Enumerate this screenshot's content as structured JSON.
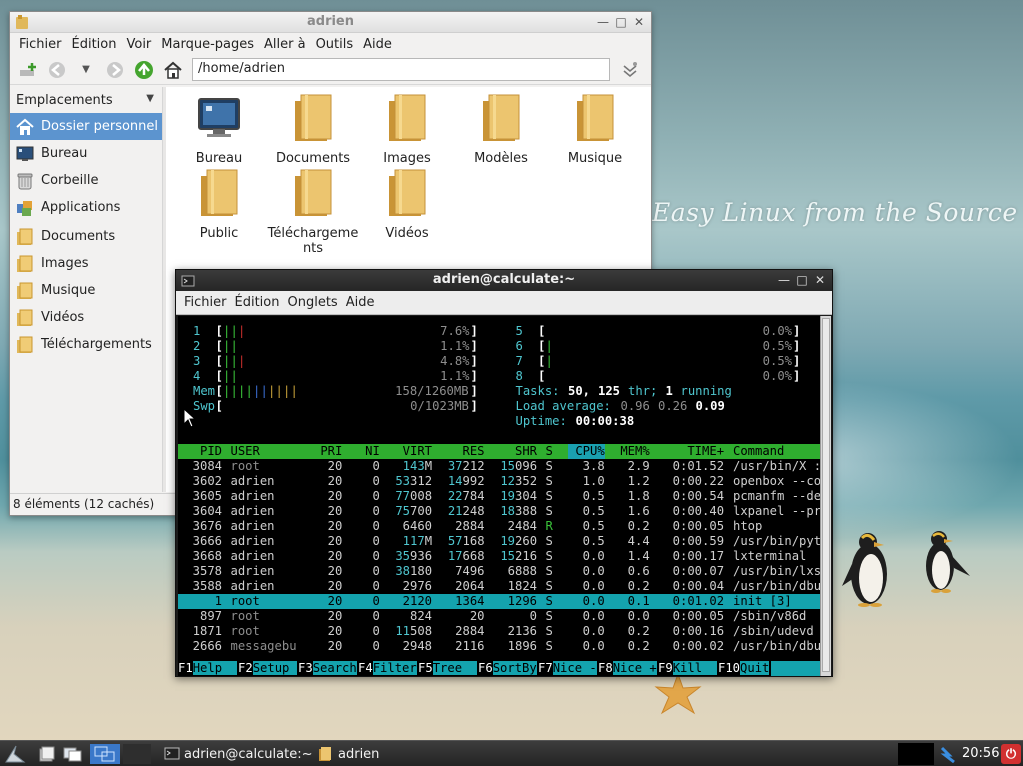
{
  "desktop": {
    "slogan": "Easy Linux from the Source"
  },
  "file_manager": {
    "title": "adrien",
    "menu": [
      "Fichier",
      "Édition",
      "Voir",
      "Marque-pages",
      "Aller à",
      "Outils",
      "Aide"
    ],
    "path": "/home/adrien",
    "sidebar_header": "Emplacements",
    "places": [
      {
        "label": "Dossier personnel",
        "icon": "home-icon",
        "active": true
      },
      {
        "label": "Bureau",
        "icon": "desktop-icon"
      },
      {
        "label": "Corbeille",
        "icon": "trash-icon"
      },
      {
        "label": "Applications",
        "icon": "applications-icon"
      }
    ],
    "bookmarks": [
      {
        "label": "Documents",
        "icon": "folder-icon"
      },
      {
        "label": "Images",
        "icon": "folder-icon"
      },
      {
        "label": "Musique",
        "icon": "folder-icon"
      },
      {
        "label": "Vidéos",
        "icon": "folder-icon"
      },
      {
        "label": "Téléchargements",
        "icon": "folder-icon"
      }
    ],
    "items": [
      {
        "label": "Bureau",
        "icon": "desktop-icon"
      },
      {
        "label": "Documents",
        "icon": "folder-icon"
      },
      {
        "label": "Images",
        "icon": "folder-icon"
      },
      {
        "label": "Modèles",
        "icon": "folder-icon"
      },
      {
        "label": "Musique",
        "icon": "folder-icon"
      },
      {
        "label": "Public",
        "icon": "folder-icon"
      },
      {
        "label": "Télécharge­ments",
        "line1": "Téléchargeme",
        "line2": "nts",
        "icon": "folder-icon"
      },
      {
        "label": "Vidéos",
        "icon": "folder-icon"
      }
    ],
    "status": "8 éléments (12 cachés)"
  },
  "terminal": {
    "title": "adrien@calculate:~",
    "menu": [
      "Fichier",
      "Édition",
      "Onglets",
      "Aide"
    ],
    "htop": {
      "cpus": [
        {
          "id": "1",
          "bar": "|||",
          "pct": "7.6%"
        },
        {
          "id": "2",
          "bar": "||",
          "pct": "1.1%"
        },
        {
          "id": "3",
          "bar": "|||",
          "pct": "4.8%"
        },
        {
          "id": "4",
          "bar": "||",
          "pct": "1.1%"
        },
        {
          "id": "5",
          "bar": "",
          "pct": "0.0%"
        },
        {
          "id": "6",
          "bar": "|",
          "pct": "0.5%"
        },
        {
          "id": "7",
          "bar": "|",
          "pct": "0.5%"
        },
        {
          "id": "8",
          "bar": "",
          "pct": "0.0%"
        }
      ],
      "mem_label": "Mem",
      "mem_value": "158/1260MB",
      "swp_label": "Swp",
      "swp_value": "0/1023MB",
      "tasks_label": "Tasks:",
      "tasks_count": "50",
      "threads": "125",
      "thr_label": "thr;",
      "running": "1",
      "running_label": "running",
      "load_label": "Load average:",
      "load1": "0.96",
      "load5": "0.26",
      "load15": "0.09",
      "uptime_label": "Uptime:",
      "uptime": "00:00:38",
      "columns": [
        "PID",
        "USER",
        "PRI",
        "NI",
        "VIRT",
        "RES",
        "SHR",
        "S",
        "CPU%",
        "MEM%",
        "TIME+",
        "Command"
      ],
      "processes": [
        {
          "pid": "3084",
          "user": "root",
          "pri": "20",
          "ni": "0",
          "virt": "143M",
          "res": "37212",
          "shr": "15096",
          "s": "S",
          "cpu": "3.8",
          "mem": "2.9",
          "time": "0:01.52",
          "cmd": "/usr/bin/X :0 -se"
        },
        {
          "pid": "3602",
          "user": "adrien",
          "pri": "20",
          "ni": "0",
          "virt": "53312",
          "res": "14992",
          "shr": "12352",
          "s": "S",
          "cpu": "1.0",
          "mem": "1.2",
          "time": "0:00.22",
          "cmd": "openbox --config-"
        },
        {
          "pid": "3605",
          "user": "adrien",
          "pri": "20",
          "ni": "0",
          "virt": "77008",
          "res": "22784",
          "shr": "19304",
          "s": "S",
          "cpu": "0.5",
          "mem": "1.8",
          "time": "0:00.54",
          "cmd": "pcmanfm --desktop"
        },
        {
          "pid": "3604",
          "user": "adrien",
          "pri": "20",
          "ni": "0",
          "virt": "75700",
          "res": "21248",
          "shr": "18388",
          "s": "S",
          "cpu": "0.5",
          "mem": "1.6",
          "time": "0:00.40",
          "cmd": "lxpanel --profile"
        },
        {
          "pid": "3676",
          "user": "adrien",
          "pri": "20",
          "ni": "0",
          "virt": "6460",
          "res": "2884",
          "shr": "2484",
          "s": "R",
          "cpu": "0.5",
          "mem": "0.2",
          "time": "0:00.05",
          "cmd": "htop"
        },
        {
          "pid": "3666",
          "user": "adrien",
          "pri": "20",
          "ni": "0",
          "virt": "117M",
          "res": "57168",
          "shr": "19260",
          "s": "S",
          "cpu": "0.5",
          "mem": "4.4",
          "time": "0:00.59",
          "cmd": "/usr/bin/python2."
        },
        {
          "pid": "3668",
          "user": "adrien",
          "pri": "20",
          "ni": "0",
          "virt": "35936",
          "res": "17668",
          "shr": "15216",
          "s": "S",
          "cpu": "0.0",
          "mem": "1.4",
          "time": "0:00.17",
          "cmd": "lxterminal"
        },
        {
          "pid": "3578",
          "user": "adrien",
          "pri": "20",
          "ni": "0",
          "virt": "38180",
          "res": "7496",
          "shr": "6888",
          "s": "S",
          "cpu": "0.0",
          "mem": "0.6",
          "time": "0:00.07",
          "cmd": "/usr/bin/lxsessio"
        },
        {
          "pid": "3588",
          "user": "adrien",
          "pri": "20",
          "ni": "0",
          "virt": "2976",
          "res": "2064",
          "shr": "1824",
          "s": "S",
          "cpu": "0.0",
          "mem": "0.2",
          "time": "0:00.04",
          "cmd": "/usr/bin/dbus-dae"
        },
        {
          "pid": "1",
          "user": "root",
          "pri": "20",
          "ni": "0",
          "virt": "2120",
          "res": "1364",
          "shr": "1296",
          "s": "S",
          "cpu": "0.0",
          "mem": "0.1",
          "time": "0:01.02",
          "cmd": "init [3]",
          "selected": true
        },
        {
          "pid": "897",
          "user": "root",
          "pri": "20",
          "ni": "0",
          "virt": "824",
          "res": "20",
          "shr": "0",
          "s": "S",
          "cpu": "0.0",
          "mem": "0.0",
          "time": "0:00.05",
          "cmd": "/sbin/v86d"
        },
        {
          "pid": "1871",
          "user": "root",
          "pri": "20",
          "ni": "0",
          "virt": "11508",
          "res": "2884",
          "shr": "2136",
          "s": "S",
          "cpu": "0.0",
          "mem": "0.2",
          "time": "0:00.16",
          "cmd": "/sbin/udevd --dae"
        },
        {
          "pid": "2666",
          "user": "messagebu",
          "pri": "20",
          "ni": "0",
          "virt": "2948",
          "res": "2116",
          "shr": "1896",
          "s": "S",
          "cpu": "0.0",
          "mem": "0.2",
          "time": "0:00.02",
          "cmd": "/usr/bin/dbus-dae"
        }
      ],
      "fkeys": [
        {
          "key": "F1",
          "label": "Help  "
        },
        {
          "key": "F2",
          "label": "Setup "
        },
        {
          "key": "F3",
          "label": "Search"
        },
        {
          "key": "F4",
          "label": "Filter"
        },
        {
          "key": "F5",
          "label": "Tree  "
        },
        {
          "key": "F6",
          "label": "SortBy"
        },
        {
          "key": "F7",
          "label": "Nice -"
        },
        {
          "key": "F8",
          "label": "Nice +"
        },
        {
          "key": "F9",
          "label": "Kill  "
        },
        {
          "key": "F10",
          "label": "Quit"
        }
      ]
    }
  },
  "taskbar": {
    "tasks": [
      {
        "label": "adrien@calculate:~",
        "icon": "terminal-icon"
      },
      {
        "label": "adrien",
        "icon": "folder-icon"
      }
    ],
    "clock": "20:56"
  },
  "colors": {
    "selection": "#5c94cf",
    "htop_header": "#2fae2f",
    "htop_cyan": "#14a3ae",
    "folder": "#e0b85a"
  }
}
